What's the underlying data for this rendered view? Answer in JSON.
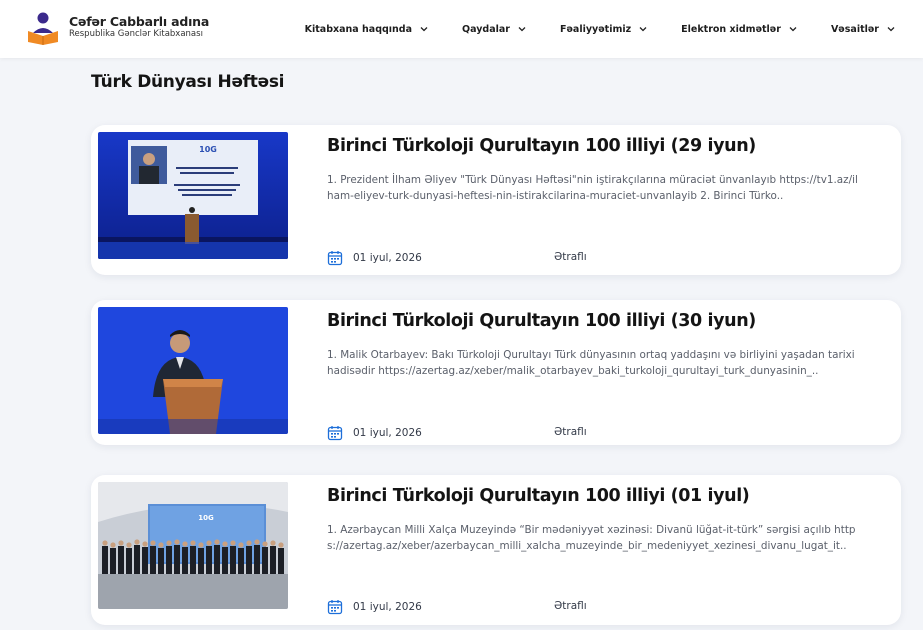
{
  "header": {
    "logo_title": "Cəfər Cabbarlı adına",
    "logo_subtitle": "Respublika Gənclər Kitabxanası",
    "nav": [
      {
        "label": "Kitabxana haqqında"
      },
      {
        "label": "Qaydalar"
      },
      {
        "label": "Fəaliyyətimiz"
      },
      {
        "label": "Elektron xidmətlər"
      },
      {
        "label": "Vəsaitlər"
      }
    ]
  },
  "page": {
    "title": "Türk Dünyası Həftəsi"
  },
  "cards": [
    {
      "title": "Birinci Türkoloji Qurultayın 100 illiyi (29 iyun)",
      "desc": "1. Prezident İlham Əliyev \"Türk Dünyası Həftəsi\"nin iştirakçılarına müraciət ünvanlayıb https://tv1.az/ilham-eliyev-turk-dunyasi-heftesi-nin-istirakcilarina-muraciet-unvanlayib  2. Birinci Türko..",
      "date": "01 iyul, 2026",
      "more": "Ətraflı"
    },
    {
      "title": "Birinci Türkoloji Qurultayın 100 illiyi (30 iyun)",
      "desc": "1. Malik Otarbayev: Bakı Türkoloji Qurultayı Türk dünyasının ortaq yaddaşını və birliyini yaşadan tarixi hadisədir https://azertag.az/xeber/malik_otarbayev_baki_turkoloji_qurultayi_turk_dunyasinin_..",
      "date": "01 iyul, 2026",
      "more": "Ətraflı"
    },
    {
      "title": "Birinci Türkoloji Qurultayın 100 illiyi (01 iyul)",
      "desc": "1. Azərbaycan Milli Xalça Muzeyində “Bir mədəniyyət xəzinəsi: Divanü lüğat-it-türk” sərgisi açılıb https://azertag.az/xeber/azerbaycan_milli_xalcha_muzeyinde_bir_medeniyyet_xezinesi_divanu_lugat_it..",
      "date": "01 iyul, 2026",
      "more": "Ətraflı"
    }
  ],
  "colors": {
    "accent_blue": "#1e6fd9",
    "logo_orange": "#f08a24",
    "logo_purple": "#3b2a8c",
    "page_bg": "#f3f5f9"
  }
}
